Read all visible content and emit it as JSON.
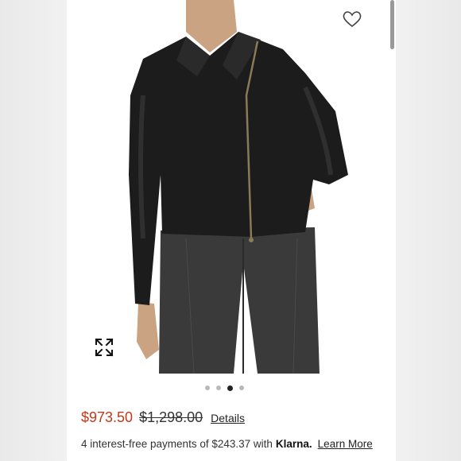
{
  "product": {
    "image_alt": "Black leather cropped moto jacket with asymmetric zip worn with black wide-leg jeans",
    "carousel": {
      "total": 4,
      "active_index": 2
    },
    "sale_price": "$973.50",
    "original_price": "$1,298.00",
    "details_label": "Details"
  },
  "financing": {
    "text": "4 interest-free payments of $243.37 with",
    "brand": "Klarna.",
    "learn_more": "Learn More"
  },
  "icons": {
    "favorite": "heart-outline-icon",
    "fullscreen": "expand-arrows-icon"
  },
  "colors": {
    "sale_price": "#c0391b",
    "jacket": "#1c1c1c",
    "jeans": "#3a3a3a",
    "dot_active": "#222222",
    "dot_inactive": "#b9b9b9"
  }
}
